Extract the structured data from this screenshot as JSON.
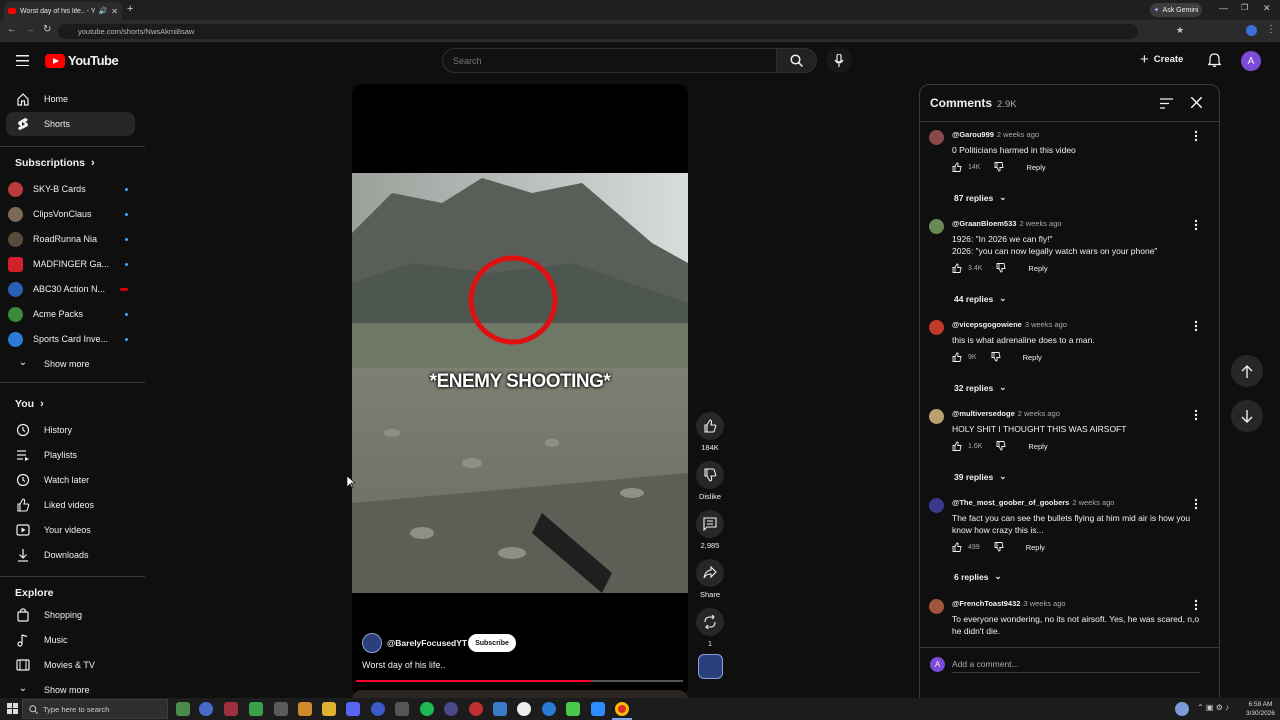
{
  "browser": {
    "tab_title": "Worst day of his life.. - YouTube",
    "url": "youtube.com/shorts/NwsAkmi8saw",
    "gemini_label": "Ask Gemini"
  },
  "header": {
    "logo_text": "YouTube",
    "search_placeholder": "Search",
    "create_label": "Create",
    "avatar_letter": "A"
  },
  "sidebar": {
    "top_items": [
      {
        "label": "Home"
      },
      {
        "label": "Shorts"
      }
    ],
    "subscriptions_title": "Subscriptions",
    "subscriptions": [
      {
        "label": "SKY-B Cards"
      },
      {
        "label": "ClipsVonClaus"
      },
      {
        "label": "RoadRunna Nia"
      },
      {
        "label": "MADFINGER Ga..."
      },
      {
        "label": "ABC30 Action N..."
      },
      {
        "label": "Acme Packs"
      },
      {
        "label": "Sports Card Inve..."
      }
    ],
    "show_more": "Show more",
    "you_title": "You",
    "you_items": [
      {
        "label": "History"
      },
      {
        "label": "Playlists"
      },
      {
        "label": "Watch later"
      },
      {
        "label": "Liked videos"
      },
      {
        "label": "Your videos"
      },
      {
        "label": "Downloads"
      }
    ],
    "explore_title": "Explore",
    "explore_items": [
      {
        "label": "Shopping"
      },
      {
        "label": "Music"
      },
      {
        "label": "Movies & TV"
      }
    ],
    "show_more_2": "Show more"
  },
  "video": {
    "caption": "*ENEMY SHOOTING*",
    "channel": "@BarelyFocusedYT",
    "subscribe": "Subscribe",
    "title": "Worst day of his life..",
    "progress": 0.72
  },
  "actions": {
    "likes": "184K",
    "dislike": "Dislike",
    "comments": "2,985",
    "share": "Share",
    "remix": "1"
  },
  "comments": {
    "title": "Comments",
    "count": "2.9K",
    "add_placeholder": "Add a comment...",
    "add_avatar": "A",
    "reply_label": "Reply",
    "items": [
      {
        "user": "@Garou999",
        "time": "2 weeks ago",
        "text": "0 Politicians harmed in this video",
        "likes": "14K",
        "replies": "87 replies"
      },
      {
        "user": "@GraanBloem533",
        "time": "2 weeks ago",
        "text": "1926: \"In 2026 we can fly!\"",
        "text2": "2026: \"you can now legally watch wars on your phone\"",
        "likes": "3.4K",
        "replies": "44 replies"
      },
      {
        "user": "@vicepsgogowiene",
        "time": "3 weeks ago",
        "text": "this is what adrenaline does to a man.",
        "likes": "9K",
        "replies": "32 replies"
      },
      {
        "user": "@multiversedoge",
        "time": "2 weeks ago",
        "text": "HOLY SHIT I THOUGHT THIS WAS AIRSOFT",
        "likes": "1.6K",
        "replies": "39 replies"
      },
      {
        "user": "@The_most_goober_of_goobers",
        "time": "2 weeks ago",
        "text": "The fact you can see the bullets flying at him mid air is how you know how crazy this is...",
        "likes": "499",
        "replies": "6 replies"
      },
      {
        "user": "@FrenchToast9432",
        "time": "3 weeks ago",
        "text": "To everyone wondering, no its not airsoft. Yes, he was scared, n,o he didn't die."
      }
    ]
  },
  "taskbar": {
    "search_placeholder": "Type here to search",
    "time": "6:58 AM",
    "date": "3/30/2026"
  },
  "colors": {
    "yt_red": "#ff0000",
    "accent_purple": "#7b4ad6",
    "link_blue": "#3ea6ff"
  }
}
